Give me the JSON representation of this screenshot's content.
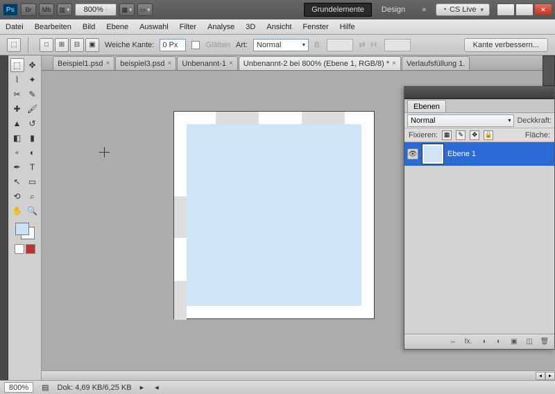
{
  "app": {
    "ps_label": "Ps",
    "br": "Br",
    "mb": "Mb",
    "zoom": "800%"
  },
  "workspace": {
    "active": "Grundelemente",
    "other": "Design",
    "more": "»",
    "cslive": "CS Live"
  },
  "menu": [
    "Datei",
    "Bearbeiten",
    "Bild",
    "Ebene",
    "Auswahl",
    "Filter",
    "Analyse",
    "3D",
    "Ansicht",
    "Fenster",
    "Hilfe"
  ],
  "options": {
    "weiche": "Weiche Kante:",
    "weiche_val": "0 Px",
    "glatten": "Glätten",
    "art": "Art:",
    "art_val": "Normal",
    "b": "B:",
    "h": "H:",
    "verbessern": "Kante verbessern..."
  },
  "doctabs": [
    {
      "label": "Beispiel1.psd",
      "close": "×"
    },
    {
      "label": "beispiel3.psd",
      "close": "×"
    },
    {
      "label": "Unbenannt-1",
      "close": "×"
    },
    {
      "label": "Unbenannt-2 bei 800% (Ebene 1, RGB/8) *",
      "close": "×",
      "active": true
    },
    {
      "label": "Verlaufsfüllung 1.",
      "close": ""
    }
  ],
  "status": {
    "zoom": "800%",
    "dok": "Dok: 4,69 KB/6,25 KB"
  },
  "layers": {
    "tab": "Ebenen",
    "blend": "Normal",
    "deckkraft": "Deckkraft:",
    "fixieren": "Fixieren:",
    "flaeche": "Fläche:",
    "items": [
      {
        "name": "Ebene 1"
      }
    ]
  }
}
